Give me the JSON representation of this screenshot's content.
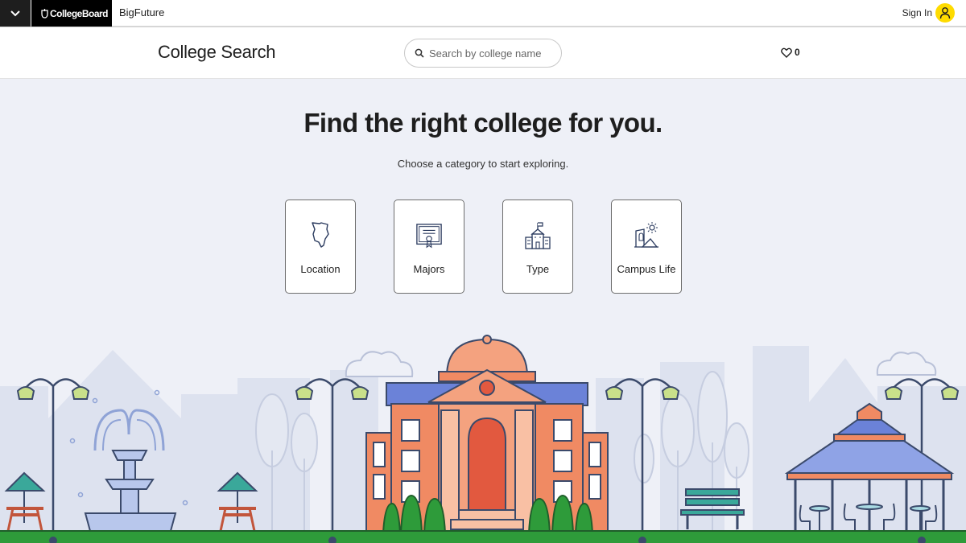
{
  "topbar": {
    "brand": "CollegeBoard",
    "product": "BigFuture",
    "sign_in": "Sign In"
  },
  "header": {
    "title": "College Search",
    "search_placeholder": "Search by college name",
    "favorites_count": "0"
  },
  "hero": {
    "title": "Find the right college for you.",
    "subtitle": "Choose a category to start exploring."
  },
  "categories": [
    {
      "label": "Location",
      "icon": "map-icon"
    },
    {
      "label": "Majors",
      "icon": "diploma-icon"
    },
    {
      "label": "Type",
      "icon": "school-building-icon"
    },
    {
      "label": "Campus Life",
      "icon": "campus-life-icon"
    }
  ],
  "colors": {
    "brand_yellow": "#fedb00",
    "brand_black": "#000000",
    "background": "#eef0f7",
    "grass": "#2e9b3a",
    "building": "#f08a63"
  }
}
